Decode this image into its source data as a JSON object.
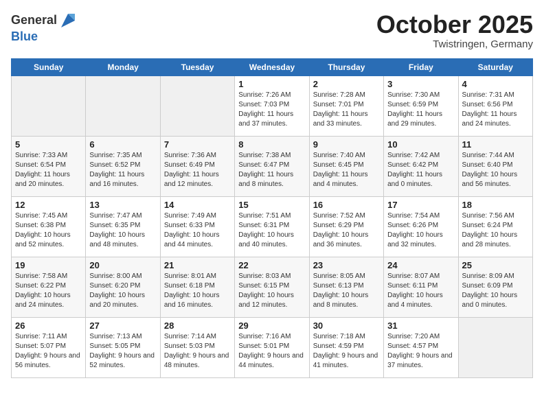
{
  "header": {
    "logo_general": "General",
    "logo_blue": "Blue",
    "month": "October 2025",
    "location": "Twistringen, Germany"
  },
  "weekdays": [
    "Sunday",
    "Monday",
    "Tuesday",
    "Wednesday",
    "Thursday",
    "Friday",
    "Saturday"
  ],
  "weeks": [
    [
      {
        "day": "",
        "empty": true
      },
      {
        "day": "",
        "empty": true
      },
      {
        "day": "",
        "empty": true
      },
      {
        "day": "1",
        "sunrise": "7:26 AM",
        "sunset": "7:03 PM",
        "daylight": "11 hours and 37 minutes."
      },
      {
        "day": "2",
        "sunrise": "7:28 AM",
        "sunset": "7:01 PM",
        "daylight": "11 hours and 33 minutes."
      },
      {
        "day": "3",
        "sunrise": "7:30 AM",
        "sunset": "6:59 PM",
        "daylight": "11 hours and 29 minutes."
      },
      {
        "day": "4",
        "sunrise": "7:31 AM",
        "sunset": "6:56 PM",
        "daylight": "11 hours and 24 minutes."
      }
    ],
    [
      {
        "day": "5",
        "sunrise": "7:33 AM",
        "sunset": "6:54 PM",
        "daylight": "11 hours and 20 minutes."
      },
      {
        "day": "6",
        "sunrise": "7:35 AM",
        "sunset": "6:52 PM",
        "daylight": "11 hours and 16 minutes."
      },
      {
        "day": "7",
        "sunrise": "7:36 AM",
        "sunset": "6:49 PM",
        "daylight": "11 hours and 12 minutes."
      },
      {
        "day": "8",
        "sunrise": "7:38 AM",
        "sunset": "6:47 PM",
        "daylight": "11 hours and 8 minutes."
      },
      {
        "day": "9",
        "sunrise": "7:40 AM",
        "sunset": "6:45 PM",
        "daylight": "11 hours and 4 minutes."
      },
      {
        "day": "10",
        "sunrise": "7:42 AM",
        "sunset": "6:42 PM",
        "daylight": "11 hours and 0 minutes."
      },
      {
        "day": "11",
        "sunrise": "7:44 AM",
        "sunset": "6:40 PM",
        "daylight": "10 hours and 56 minutes."
      }
    ],
    [
      {
        "day": "12",
        "sunrise": "7:45 AM",
        "sunset": "6:38 PM",
        "daylight": "10 hours and 52 minutes."
      },
      {
        "day": "13",
        "sunrise": "7:47 AM",
        "sunset": "6:35 PM",
        "daylight": "10 hours and 48 minutes."
      },
      {
        "day": "14",
        "sunrise": "7:49 AM",
        "sunset": "6:33 PM",
        "daylight": "10 hours and 44 minutes."
      },
      {
        "day": "15",
        "sunrise": "7:51 AM",
        "sunset": "6:31 PM",
        "daylight": "10 hours and 40 minutes."
      },
      {
        "day": "16",
        "sunrise": "7:52 AM",
        "sunset": "6:29 PM",
        "daylight": "10 hours and 36 minutes."
      },
      {
        "day": "17",
        "sunrise": "7:54 AM",
        "sunset": "6:26 PM",
        "daylight": "10 hours and 32 minutes."
      },
      {
        "day": "18",
        "sunrise": "7:56 AM",
        "sunset": "6:24 PM",
        "daylight": "10 hours and 28 minutes."
      }
    ],
    [
      {
        "day": "19",
        "sunrise": "7:58 AM",
        "sunset": "6:22 PM",
        "daylight": "10 hours and 24 minutes."
      },
      {
        "day": "20",
        "sunrise": "8:00 AM",
        "sunset": "6:20 PM",
        "daylight": "10 hours and 20 minutes."
      },
      {
        "day": "21",
        "sunrise": "8:01 AM",
        "sunset": "6:18 PM",
        "daylight": "10 hours and 16 minutes."
      },
      {
        "day": "22",
        "sunrise": "8:03 AM",
        "sunset": "6:15 PM",
        "daylight": "10 hours and 12 minutes."
      },
      {
        "day": "23",
        "sunrise": "8:05 AM",
        "sunset": "6:13 PM",
        "daylight": "10 hours and 8 minutes."
      },
      {
        "day": "24",
        "sunrise": "8:07 AM",
        "sunset": "6:11 PM",
        "daylight": "10 hours and 4 minutes."
      },
      {
        "day": "25",
        "sunrise": "8:09 AM",
        "sunset": "6:09 PM",
        "daylight": "10 hours and 0 minutes."
      }
    ],
    [
      {
        "day": "26",
        "sunrise": "7:11 AM",
        "sunset": "5:07 PM",
        "daylight": "9 hours and 56 minutes."
      },
      {
        "day": "27",
        "sunrise": "7:13 AM",
        "sunset": "5:05 PM",
        "daylight": "9 hours and 52 minutes."
      },
      {
        "day": "28",
        "sunrise": "7:14 AM",
        "sunset": "5:03 PM",
        "daylight": "9 hours and 48 minutes."
      },
      {
        "day": "29",
        "sunrise": "7:16 AM",
        "sunset": "5:01 PM",
        "daylight": "9 hours and 44 minutes."
      },
      {
        "day": "30",
        "sunrise": "7:18 AM",
        "sunset": "4:59 PM",
        "daylight": "9 hours and 41 minutes."
      },
      {
        "day": "31",
        "sunrise": "7:20 AM",
        "sunset": "4:57 PM",
        "daylight": "9 hours and 37 minutes."
      },
      {
        "day": "",
        "empty": true
      }
    ]
  ],
  "labels": {
    "sunrise": "Sunrise:",
    "sunset": "Sunset:",
    "daylight": "Daylight:"
  }
}
